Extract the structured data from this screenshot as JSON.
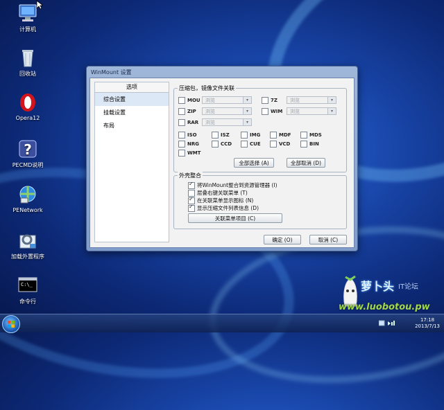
{
  "desktop": {
    "icons": [
      {
        "label": "计算机",
        "icon": "computer-icon"
      },
      {
        "label": "回收站",
        "icon": "recycle-bin-icon"
      },
      {
        "label": "Opera12",
        "icon": "opera-icon"
      },
      {
        "label": "PECMD说明",
        "icon": "help-icon"
      },
      {
        "label": "PENetwork",
        "icon": "network-icon"
      },
      {
        "label": "加载外置程序",
        "icon": "load-program-icon"
      },
      {
        "label": "命令行",
        "icon": "command-prompt-icon"
      }
    ]
  },
  "window": {
    "title": "WinMount 设置",
    "sidebar": {
      "header": "选项",
      "items": [
        "综合设置",
        "挂载设置",
        "布局"
      ],
      "selected_index": 0
    },
    "archive_group": {
      "title": "压缩包，镜像文件关联",
      "combo_rows": [
        {
          "label": "MOU",
          "combo": "浏览"
        },
        {
          "label": "7Z",
          "combo": "浏览"
        },
        {
          "label": "ZIP",
          "combo": "浏览"
        },
        {
          "label": "WIM",
          "combo": "浏览"
        },
        {
          "label": "RAR",
          "combo": "浏览"
        }
      ],
      "formats": [
        "ISO",
        "ISZ",
        "IMG",
        "MDF",
        "MDS",
        "NRG",
        "CCD",
        "CUE",
        "VCD",
        "BIN",
        "WMT"
      ],
      "select_all": "全部选择 (A)",
      "cancel_all": "全部取消 (D)"
    },
    "shell_group": {
      "title": "外壳整合",
      "options": [
        {
          "label": "将WinMount整合到资源管理器 (I)",
          "checked": true
        },
        {
          "label": "层叠右键关联菜单 (T)",
          "checked": false
        },
        {
          "label": "在关联菜单显示图标 (N)",
          "checked": true
        },
        {
          "label": "显示压缩文件列表信息 (D)",
          "checked": true
        }
      ],
      "menu_button": "关联菜单项目 (C)"
    },
    "ok": "确定 (O)",
    "cancel": "取消 (C)"
  },
  "taskbar": {
    "time": "17:18",
    "date": "2013/7/13"
  },
  "watermark": {
    "brand": "萝卜头",
    "suffix": "IT论坛",
    "url": "www.luobotou.pw"
  }
}
